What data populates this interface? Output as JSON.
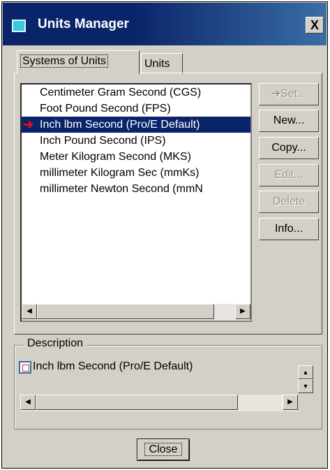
{
  "window": {
    "title": "Units Manager",
    "close_glyph": "X"
  },
  "tabs": [
    {
      "label": "Systems of Units",
      "active": true
    },
    {
      "label": "Units",
      "active": false
    }
  ],
  "units_list": {
    "items": [
      {
        "label": "Centimeter Gram Second (CGS)",
        "selected": false
      },
      {
        "label": "Foot Pound Second (FPS)",
        "selected": false
      },
      {
        "label": "Inch lbm Second (Pro/E Default)",
        "selected": true
      },
      {
        "label": "Inch Pound Second (IPS)",
        "selected": false
      },
      {
        "label": "Meter Kilogram Second (MKS)",
        "selected": false
      },
      {
        "label": "millimeter Kilogram Sec (mmKs)",
        "selected": false
      },
      {
        "label": "millimeter Newton Second (mmN",
        "selected": false
      }
    ],
    "active_marker_icon": "red-arrow-icon"
  },
  "buttons": {
    "set": "Set...",
    "new": "New...",
    "copy": "Copy...",
    "edit": "Edit...",
    "delete": "Delete",
    "info": "Info..."
  },
  "description": {
    "legend": "Description",
    "text": "Inch lbm Second (Pro/E Default)"
  },
  "footer": {
    "close": "Close"
  },
  "colors": {
    "title_bar": "#0a246a",
    "selection": "#0a246a",
    "dialog_face": "#d4d0c8",
    "active_arrow": "#e0101a"
  }
}
